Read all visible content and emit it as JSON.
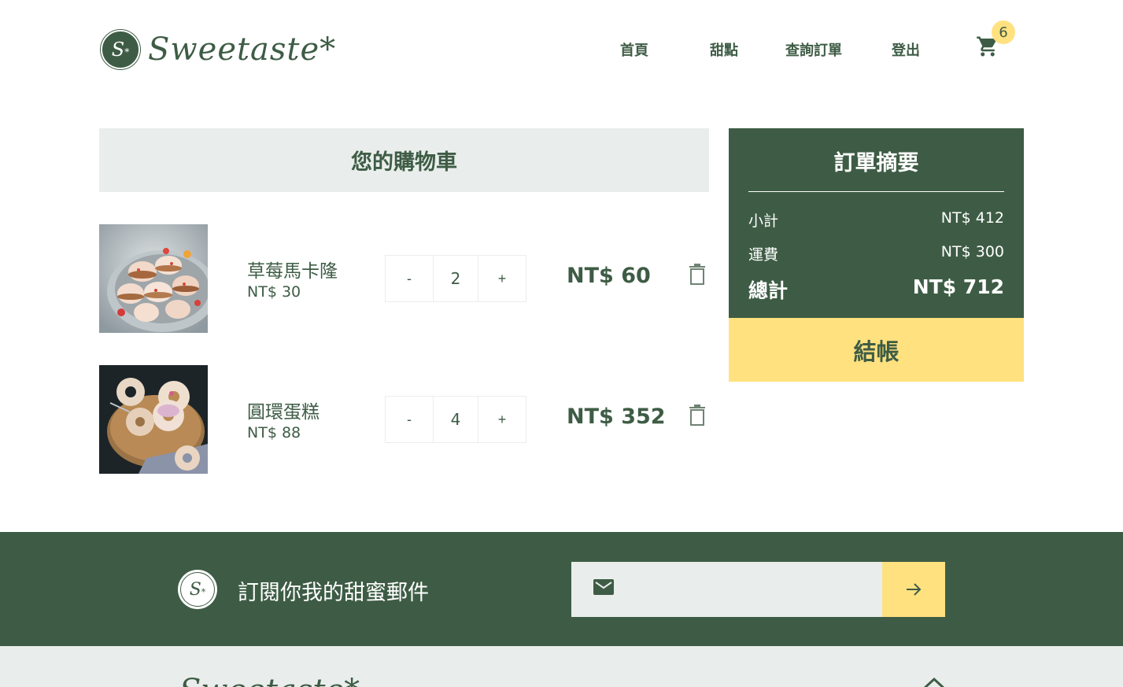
{
  "header": {
    "brand": "Sweetaste*",
    "badge_letter": "S",
    "nav": [
      "首頁",
      "甜點",
      "查詢訂單",
      "登出"
    ],
    "cart_count": "6",
    "cart_icon": "shopping-cart-icon"
  },
  "cart": {
    "title": "您的購物車",
    "items": [
      {
        "name": "草莓馬卡隆",
        "price": "NT$ 30",
        "qty": "2",
        "minus": "-",
        "plus": "+",
        "total": "NT$ 60",
        "image": "macaron-photo"
      },
      {
        "name": "圓環蛋糕",
        "price": "NT$ 88",
        "qty": "4",
        "minus": "-",
        "plus": "+",
        "total": "NT$ 352",
        "image": "ring-cake-photo"
      }
    ]
  },
  "summary": {
    "title": "訂單摘要",
    "subtotal_label": "小計",
    "subtotal_value": "NT$ 412",
    "shipping_label": "運費",
    "shipping_value": "NT$ 300",
    "total_label": "總計",
    "total_value": "NT$ 712",
    "checkout_label": "結帳"
  },
  "subscribe": {
    "text": "訂閱你我的甜蜜郵件",
    "email_value": "",
    "mail_icon": "mail-icon",
    "submit_icon": "arrow-right-icon"
  },
  "colors": {
    "primary": "#3e5c45",
    "accent": "#ffe180",
    "light": "#e9eeec"
  }
}
